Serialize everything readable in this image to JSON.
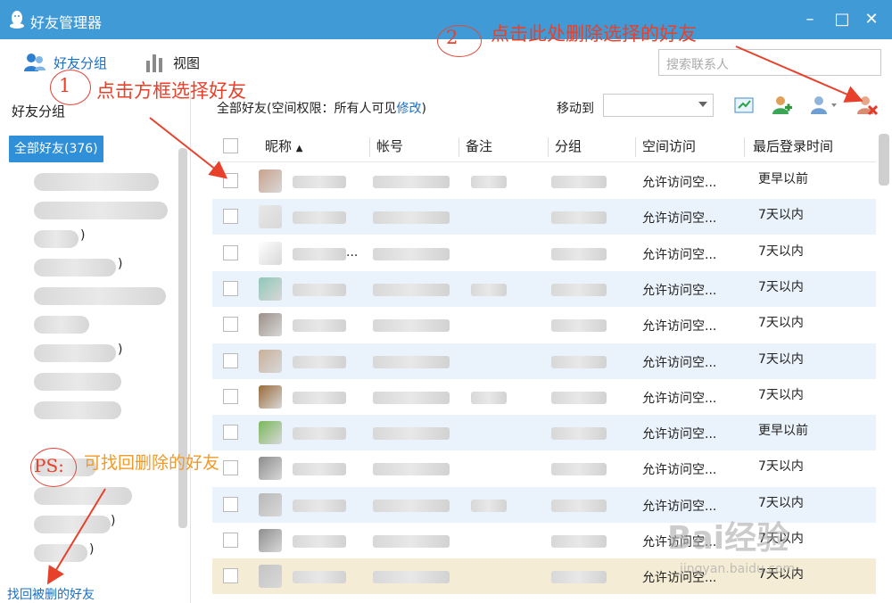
{
  "window": {
    "title": "好友管理器",
    "minimize_glyph": "–",
    "maximize_glyph": "□",
    "close_glyph": "✕"
  },
  "toolbar": {
    "friend_groups_label": "好友分组",
    "view_label": "视图",
    "search_placeholder": "搜索联系人"
  },
  "sidebar": {
    "header": "好友分组",
    "all_friends_label": "全部好友(376)",
    "visible_group_fragments": [
      ")",
      ")",
      ")",
      ")",
      ")"
    ],
    "find_deleted_label": "找回被删的好友"
  },
  "content_header": {
    "all_friends_prefix": "全部好友(空间权限：所有人可见",
    "modify_link": "修改",
    "suffix": ")",
    "move_to_label": "移动到"
  },
  "table": {
    "columns": [
      "昵称",
      "帐号",
      "备注",
      "分组",
      "空间访问",
      "最后登录时间"
    ],
    "sort_indicator": "▲",
    "rows": [
      {
        "nick": "",
        "space": "允许访问空...",
        "last_login": "更早以前"
      },
      {
        "nick": "",
        "space": "允许访问空...",
        "last_login": "7天以内"
      },
      {
        "nick": "...",
        "space": "允许访问空...",
        "last_login": "7天以内"
      },
      {
        "nick": "_",
        "space": "允许访问空...",
        "last_login": "7天以内"
      },
      {
        "nick": "",
        "space": "允许访问空...",
        "last_login": "7天以内"
      },
      {
        "nick": "",
        "space": "允许访问空...",
        "last_login": "7天以内"
      },
      {
        "nick": "",
        "space": "允许访问空...",
        "last_login": "7天以内"
      },
      {
        "nick": "",
        "space": "允许访问空...",
        "last_login": "更早以前"
      },
      {
        "nick": "",
        "space": "允许访问空...",
        "last_login": "7天以内"
      },
      {
        "nick": "",
        "space": "允许访问空...",
        "last_login": "7天以内"
      },
      {
        "nick": "",
        "space": "允许访问空...",
        "last_login": "7天以内"
      },
      {
        "nick": "",
        "space": "允许访问空...",
        "last_login": "7天以内"
      }
    ]
  },
  "annotations": {
    "step1_num": "1",
    "step1_text": "点击方框选择好友",
    "step2_num": "2",
    "step2_text": "点击此处删除选择的好友",
    "ps_label": "PS:",
    "ps_text": "可找回删除的好友"
  },
  "watermark": {
    "brand": "Bai经验",
    "url": "jingyan.baidu.com"
  },
  "colors": {
    "titlebar": "#3f9ad6",
    "accent": "#2f8fd8",
    "link": "#1a6fc4",
    "row_alt": "#eaf3fb",
    "annotation_red": "#e7412b",
    "annotation_orange": "#f09a2b"
  }
}
